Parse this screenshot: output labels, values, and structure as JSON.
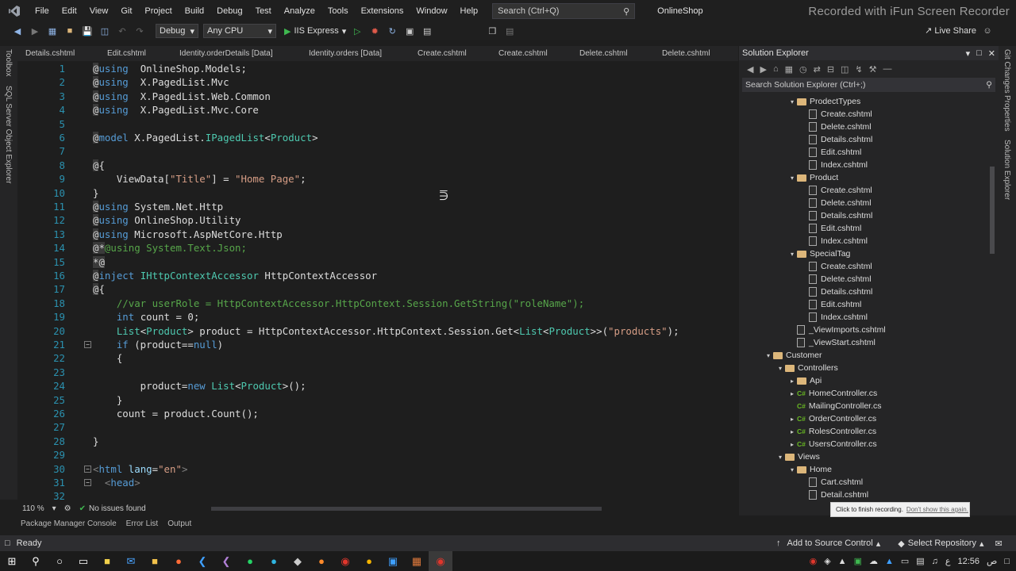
{
  "menubar": {
    "items": [
      "File",
      "Edit",
      "View",
      "Git",
      "Project",
      "Build",
      "Debug",
      "Test",
      "Analyze",
      "Tools",
      "Extensions",
      "Window",
      "Help"
    ],
    "search_placeholder": "Search (Ctrl+Q)",
    "app_title": "OnlineShop",
    "watermark": "Recorded with iFun Screen Recorder"
  },
  "toolbar": {
    "config": "Debug",
    "platform": "Any CPU",
    "run_target": "IIS Express",
    "live_share": "Live Share"
  },
  "left_strip": {
    "toolbox": "Toolbox",
    "sql_explorer": "SQL Server Object Explorer"
  },
  "right_strip": {
    "git_changes": "Git Changes",
    "properties": "Properties",
    "solution_explorer": "Solution Explorer"
  },
  "tabs": [
    "Details.cshtml",
    "Edit.cshtml",
    "Identity.orderDetails [Data]",
    "Identity.orders [Data]",
    "Create.cshtml",
    "Create.cshtml",
    "Delete.cshtml",
    "Delete.cshtml"
  ],
  "editor": {
    "lines": [
      {
        "n": "1",
        "t": [
          [
            "rz",
            "@"
          ],
          [
            "kw",
            "using"
          ],
          [
            "",
            "  OnlineShop.Models;"
          ]
        ]
      },
      {
        "n": "2",
        "t": [
          [
            "rz",
            "@"
          ],
          [
            "kw",
            "using"
          ],
          [
            "",
            "  X.PagedList.Mvc"
          ]
        ]
      },
      {
        "n": "3",
        "t": [
          [
            "rz",
            "@"
          ],
          [
            "kw",
            "using"
          ],
          [
            "",
            "  X.PagedList.Web.Common"
          ]
        ]
      },
      {
        "n": "4",
        "t": [
          [
            "rz",
            "@"
          ],
          [
            "kw",
            "using"
          ],
          [
            "",
            "  X.PagedList.Mvc.Core"
          ]
        ]
      },
      {
        "n": "5",
        "t": []
      },
      {
        "n": "6",
        "t": [
          [
            "rz",
            "@"
          ],
          [
            "kw",
            "model"
          ],
          [
            "",
            " X.PagedList."
          ],
          [
            "ty",
            "IPagedList"
          ],
          [
            "",
            "<"
          ],
          [
            "ty",
            "Product"
          ],
          [
            "",
            ">"
          ]
        ]
      },
      {
        "n": "7",
        "t": []
      },
      {
        "n": "8",
        "t": [
          [
            "rz",
            "@"
          ],
          [
            "",
            "{"
          ]
        ]
      },
      {
        "n": "9",
        "t": [
          [
            "",
            "    ViewData["
          ],
          [
            "st",
            "\"Title\""
          ],
          [
            "",
            "] = "
          ],
          [
            "st",
            "\"Home Page\""
          ],
          [
            "",
            ";"
          ]
        ]
      },
      {
        "n": "10",
        "t": [
          [
            "",
            "}"
          ]
        ]
      },
      {
        "n": "11",
        "t": [
          [
            "rz",
            "@"
          ],
          [
            "kw",
            "using"
          ],
          [
            "",
            " System.Net.Http"
          ]
        ]
      },
      {
        "n": "12",
        "t": [
          [
            "rz",
            "@"
          ],
          [
            "kw",
            "using"
          ],
          [
            "",
            " OnlineShop.Utility"
          ]
        ]
      },
      {
        "n": "13",
        "t": [
          [
            "rz",
            "@"
          ],
          [
            "kw",
            "using"
          ],
          [
            "",
            " Microsoft.AspNetCore.Http"
          ]
        ]
      },
      {
        "n": "14",
        "t": [
          [
            "rz",
            "@*"
          ],
          [
            "cm",
            "@using System.Text.Json;"
          ]
        ]
      },
      {
        "n": "15",
        "t": [
          [
            "rz",
            "*@"
          ]
        ]
      },
      {
        "n": "16",
        "t": [
          [
            "rz",
            "@"
          ],
          [
            "kw",
            "inject"
          ],
          [
            "",
            " "
          ],
          [
            "ty",
            "IHttpContextAccessor"
          ],
          [
            "",
            " HttpContextAccessor"
          ]
        ]
      },
      {
        "n": "17",
        "t": [
          [
            "rz",
            "@"
          ],
          [
            "",
            "{"
          ]
        ]
      },
      {
        "n": "18",
        "t": [
          [
            "",
            "    "
          ],
          [
            "cm",
            "//var userRole = HttpContextAccessor.HttpContext.Session.GetString(\"roleName\");"
          ]
        ]
      },
      {
        "n": "19",
        "t": [
          [
            "",
            "    "
          ],
          [
            "kw",
            "int"
          ],
          [
            "",
            " count = 0;"
          ]
        ]
      },
      {
        "n": "20",
        "t": [
          [
            "",
            "    "
          ],
          [
            "ty",
            "List"
          ],
          [
            "",
            "<"
          ],
          [
            "ty",
            "Product"
          ],
          [
            "",
            "> product = HttpContextAccessor.HttpContext.Session.Get<"
          ],
          [
            "ty",
            "List"
          ],
          [
            "",
            "<"
          ],
          [
            "ty",
            "Product"
          ],
          [
            "",
            ">>("
          ],
          [
            "st",
            "\"products\""
          ],
          [
            "",
            ");"
          ]
        ]
      },
      {
        "n": "21",
        "t": [
          [
            "",
            "    "
          ],
          [
            "kw",
            "if"
          ],
          [
            "",
            " (product=="
          ],
          [
            "kw",
            "null"
          ],
          [
            "",
            ")"
          ]
        ],
        "fold": true
      },
      {
        "n": "22",
        "t": [
          [
            "",
            "    {"
          ]
        ]
      },
      {
        "n": "23",
        "t": []
      },
      {
        "n": "24",
        "t": [
          [
            "",
            "        product="
          ],
          [
            "kw",
            "new"
          ],
          [
            "",
            " "
          ],
          [
            "ty",
            "List"
          ],
          [
            "",
            "<"
          ],
          [
            "ty",
            "Product"
          ],
          [
            "",
            ">();"
          ]
        ]
      },
      {
        "n": "25",
        "t": [
          [
            "",
            "    }"
          ]
        ]
      },
      {
        "n": "26",
        "t": [
          [
            "",
            "    count = product.Count();"
          ]
        ]
      },
      {
        "n": "27",
        "t": []
      },
      {
        "n": "28",
        "t": [
          [
            "",
            "}"
          ]
        ]
      },
      {
        "n": "29",
        "t": []
      },
      {
        "n": "30",
        "t": [
          [
            "tg",
            "<"
          ],
          [
            "kw",
            "html"
          ],
          [
            "",
            " "
          ],
          [
            "ag",
            "lang"
          ],
          [
            "",
            "="
          ],
          [
            "st",
            "\"en\""
          ],
          [
            "tg",
            ">"
          ]
        ],
        "fold": true
      },
      {
        "n": "31",
        "t": [
          [
            "",
            "  "
          ],
          [
            "tg",
            "<"
          ],
          [
            "kw",
            "head"
          ],
          [
            "tg",
            ">"
          ]
        ],
        "fold": true
      },
      {
        "n": "32",
        "t": []
      }
    ]
  },
  "editor_status": {
    "zoom": "110 %",
    "issues": "No issues found"
  },
  "bottom_tabs": [
    "Package Manager Console",
    "Error List",
    "Output"
  ],
  "solution_explorer": {
    "title": "Solution Explorer",
    "search_placeholder": "Search Solution Explorer (Ctrl+;)",
    "tree": [
      {
        "label": "ProdectTypes",
        "kind": "folder",
        "depth": 3,
        "arrow": "▾"
      },
      {
        "label": "Create.cshtml",
        "kind": "file",
        "depth": 4
      },
      {
        "label": "Delete.cshtml",
        "kind": "file",
        "depth": 4
      },
      {
        "label": "Details.cshtml",
        "kind": "file",
        "depth": 4
      },
      {
        "label": "Edit.cshtml",
        "kind": "file",
        "depth": 4
      },
      {
        "label": "Index.cshtml",
        "kind": "file",
        "depth": 4
      },
      {
        "label": "Product",
        "kind": "folder",
        "depth": 3,
        "arrow": "▾"
      },
      {
        "label": "Create.cshtml",
        "kind": "file",
        "depth": 4
      },
      {
        "label": "Delete.cshtml",
        "kind": "file",
        "depth": 4
      },
      {
        "label": "Details.cshtml",
        "kind": "file",
        "depth": 4
      },
      {
        "label": "Edit.cshtml",
        "kind": "file",
        "depth": 4
      },
      {
        "label": "Index.cshtml",
        "kind": "file",
        "depth": 4
      },
      {
        "label": "SpecialTag",
        "kind": "folder",
        "depth": 3,
        "arrow": "▾"
      },
      {
        "label": "Create.cshtml",
        "kind": "file",
        "depth": 4
      },
      {
        "label": "Delete.cshtml",
        "kind": "file",
        "depth": 4
      },
      {
        "label": "Details.cshtml",
        "kind": "file",
        "depth": 4
      },
      {
        "label": "Edit.cshtml",
        "kind": "file",
        "depth": 4
      },
      {
        "label": "Index.cshtml",
        "kind": "file",
        "depth": 4
      },
      {
        "label": "_ViewImports.cshtml",
        "kind": "file",
        "depth": 3
      },
      {
        "label": "_ViewStart.cshtml",
        "kind": "file",
        "depth": 3
      },
      {
        "label": "Customer",
        "kind": "folder",
        "depth": 1,
        "arrow": "▾"
      },
      {
        "label": "Controllers",
        "kind": "folder",
        "depth": 2,
        "arrow": "▾"
      },
      {
        "label": "Api",
        "kind": "folder",
        "depth": 3,
        "arrow": "▸"
      },
      {
        "label": "HomeController.cs",
        "kind": "cs",
        "depth": 3,
        "arrow": "▸"
      },
      {
        "label": "MailingController.cs",
        "kind": "cs",
        "depth": 3
      },
      {
        "label": "OrderController.cs",
        "kind": "cs",
        "depth": 3,
        "arrow": "▸"
      },
      {
        "label": "RolesController.cs",
        "kind": "cs",
        "depth": 3,
        "arrow": "▸"
      },
      {
        "label": "UsersController.cs",
        "kind": "cs",
        "depth": 3,
        "arrow": "▸"
      },
      {
        "label": "Views",
        "kind": "folder",
        "depth": 2,
        "arrow": "▾"
      },
      {
        "label": "Home",
        "kind": "folder",
        "depth": 3,
        "arrow": "▾"
      },
      {
        "label": "Cart.cshtml",
        "kind": "file",
        "depth": 4
      },
      {
        "label": "Detail.cshtml",
        "kind": "file",
        "depth": 4
      }
    ]
  },
  "tooltip": {
    "text": "Click to finish recording.",
    "link": "Don't show this again."
  },
  "statusbar": {
    "ready": "Ready",
    "source_control": "Add to Source Control",
    "repository": "Select Repository"
  },
  "taskbar": {
    "clock": "12:56",
    "ampm": "ص",
    "lang": "ع"
  }
}
